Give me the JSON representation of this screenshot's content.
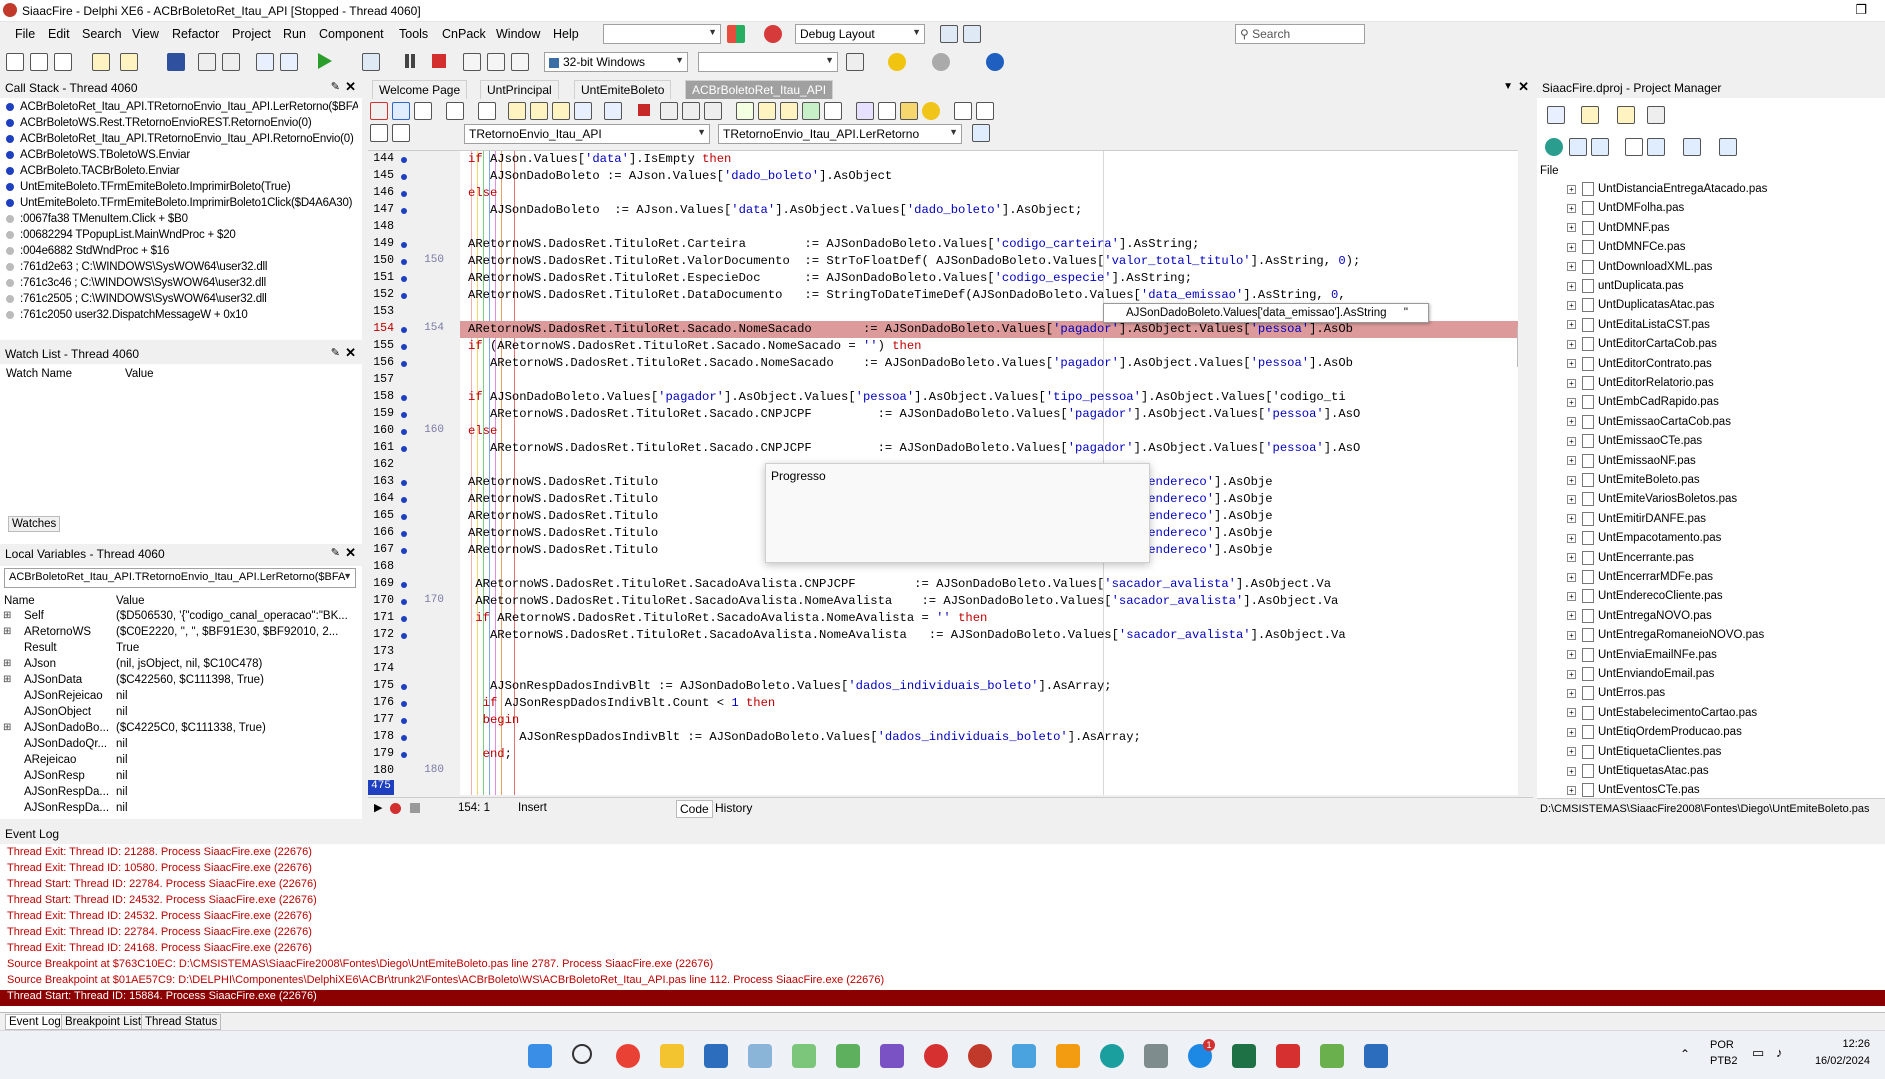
{
  "window": {
    "title": "SiaacFire - Delphi XE6 - ACBrBoletoRet_Itau_API [Stopped - Thread 4060]",
    "restore_glyph": "❐"
  },
  "menu": [
    "File",
    "Edit",
    "Search",
    "View",
    "Refactor",
    "Project",
    "Run",
    "Component",
    "Tools",
    "CnPack",
    "Window",
    "Help"
  ],
  "toolbar": {
    "layout_combo": "Debug Layout",
    "search_placeholder": "Search",
    "platform_combo": "32-bit Windows"
  },
  "callstack": {
    "title": "Call Stack - Thread 4060",
    "rows": [
      "ACBrBoletoRet_Itau_API.TRetornoEnvio_Itau_API.LerRetorno($BFA4",
      "ACBrBoletoWS.Rest.TRetornoEnvioREST.RetornoEnvio(0)",
      "ACBrBoletoRet_Itau_API.TRetornoEnvio_Itau_API.RetornoEnvio(0)",
      "ACBrBoletoWS.TBoletoWS.Enviar",
      "ACBrBoleto.TACBrBoleto.Enviar",
      "UntEmiteBoleto.TFrmEmiteBoleto.ImprimirBoleto(True)",
      "UntEmiteBoleto.TFrmEmiteBoleto.ImprimirBoleto1Click($D4A6A30)",
      ":0067fa38 TMenuItem.Click + $B0",
      ":00682294 TPopupList.MainWndProc + $20",
      ":004e6882 StdWndProc + $16",
      ":761d2e63 ; C:\\WINDOWS\\SysWOW64\\user32.dll",
      ":761c3c46 ; C:\\WINDOWS\\SysWOW64\\user32.dll",
      ":761c2505 ; C:\\WINDOWS\\SysWOW64\\user32.dll",
      ":761c2050 user32.DispatchMessageW + 0x10"
    ]
  },
  "watch": {
    "title": "Watch List - Thread 4060",
    "col_name": "Watch Name",
    "col_value": "Value",
    "tab": "Watches"
  },
  "locals": {
    "title": "Local Variables - Thread 4060",
    "combo": "ACBrBoletoRet_Itau_API.TRetornoEnvio_Itau_API.LerRetorno($BFA",
    "col_name": "Name",
    "col_value": "Value",
    "rows": [
      {
        "name": "Self",
        "value": "($D506530, '{\"codigo_canal_operacao\":\"BK..."
      },
      {
        "name": "ARetornoWS",
        "value": "($C0E2220, '', '', $BF91E30, $BF92010, 2..."
      },
      {
        "name": "Result",
        "value": "True"
      },
      {
        "name": "AJson",
        "value": "(nil, jsObject, nil, $C10C478)"
      },
      {
        "name": "AJSonData",
        "value": "($C422560, $C111398, True)"
      },
      {
        "name": "AJSonRejeicao",
        "value": "nil"
      },
      {
        "name": "AJSonObject",
        "value": "nil"
      },
      {
        "name": "AJSonDadoBo...",
        "value": "($C4225C0, $C111338, True)"
      },
      {
        "name": "AJSonDadoQr...",
        "value": "nil"
      },
      {
        "name": "ARejeicao",
        "value": "nil"
      },
      {
        "name": "AJSonResp",
        "value": "nil"
      },
      {
        "name": "AJSonRespDa...",
        "value": "nil"
      },
      {
        "name": "AJSonRespDa...",
        "value": "nil"
      }
    ]
  },
  "tabs": [
    "Welcome Page",
    "UntPrincipal",
    "UntEmiteBoleto",
    "ACBrBoletoRet_Itau_API"
  ],
  "editor_toolbar": {
    "class_combo": "TRetornoEnvio_Itau_API",
    "method_combo": "TRetornoEnvio_Itau_API.LerRetorno"
  },
  "code_lines": [
    {
      "n": "144",
      "n2": "",
      "t": "if AJson.Values['data'].IsEmpty then"
    },
    {
      "n": "145",
      "n2": "",
      "t": "   AJSonDadoBoleto := AJson.Values['dado_boleto'].AsObject"
    },
    {
      "n": "146",
      "n2": "",
      "t": "else"
    },
    {
      "n": "147",
      "n2": "",
      "t": "   AJSonDadoBoleto  := AJson.Values['data'].AsObject.Values['dado_boleto'].AsObject;"
    },
    {
      "n": "148",
      "n2": "",
      "t": ""
    },
    {
      "n": "149",
      "n2": "",
      "t": "ARetornoWS.DadosRet.TituloRet.Carteira        := AJSonDadoBoleto.Values['codigo_carteira'].AsString;"
    },
    {
      "n": "150",
      "n2": "150",
      "t": "ARetornoWS.DadosRet.TituloRet.ValorDocumento  := StrToFloatDef( AJSonDadoBoleto.Values['valor_total_titulo'].AsString, 0);"
    },
    {
      "n": "151",
      "n2": "",
      "t": "ARetornoWS.DadosRet.TituloRet.EspecieDoc      := AJSonDadoBoleto.Values['codigo_especie'].AsString;"
    },
    {
      "n": "152",
      "n2": "",
      "t": "ARetornoWS.DadosRet.TituloRet.DataDocumento   := StringToDateTimeDef(AJSonDadoBoleto.Values['data_emissao'].AsString, 0,"
    },
    {
      "n": "153",
      "n2": "",
      "t": ""
    },
    {
      "n": "154",
      "n2": "154",
      "t": "ARetornoWS.DadosRet.TituloRet.Sacado.NomeSacado       := AJSonDadoBoleto.Values['pagador'].AsObject.Values['pessoa'].AsOb"
    },
    {
      "n": "155",
      "n2": "",
      "t": "if (ARetornoWS.DadosRet.TituloRet.Sacado.NomeSacado = '') then"
    },
    {
      "n": "156",
      "n2": "",
      "t": "   ARetornoWS.DadosRet.TituloRet.Sacado.NomeSacado    := AJSonDadoBoleto.Values['pagador'].AsObject.Values['pessoa'].AsOb"
    },
    {
      "n": "157",
      "n2": "",
      "t": ""
    },
    {
      "n": "158",
      "n2": "",
      "t": "if AJSonDadoBoleto.Values['pagador'].AsObject.Values['pessoa'].AsObject.Values['tipo_pessoa'].AsObject.Values['codigo_ti"
    },
    {
      "n": "159",
      "n2": "",
      "t": "   ARetornoWS.DadosRet.TituloRet.Sacado.CNPJCPF         := AJSonDadoBoleto.Values['pagador'].AsObject.Values['pessoa'].AsO"
    },
    {
      "n": "160",
      "n2": "160",
      "t": "else"
    },
    {
      "n": "161",
      "n2": "",
      "t": "   ARetornoWS.DadosRet.TituloRet.Sacado.CNPJCPF         := AJSonDadoBoleto.Values['pagador'].AsObject.Values['pessoa'].AsO"
    },
    {
      "n": "162",
      "n2": "",
      "t": ""
    },
    {
      "n": "163",
      "n2": "",
      "t": "ARetornoWS.DadosRet.Titulo                                       'pagador'].AsObject.Values['endereco'].AsObje"
    },
    {
      "n": "164",
      "n2": "",
      "t": "ARetornoWS.DadosRet.Titulo                                       'pagador'].AsObject.Values['endereco'].AsObje"
    },
    {
      "n": "165",
      "n2": "",
      "t": "ARetornoWS.DadosRet.Titulo                                       'pagador'].AsObject.Values['endereco'].AsObje"
    },
    {
      "n": "166",
      "n2": "",
      "t": "ARetornoWS.DadosRet.Titulo                                       'pagador'].AsObject.Values['endereco'].AsObje"
    },
    {
      "n": "167",
      "n2": "",
      "t": "ARetornoWS.DadosRet.Titulo                                       'pagador'].AsObject.Values['endereco'].AsObje"
    },
    {
      "n": "168",
      "n2": "",
      "t": ""
    },
    {
      "n": "169",
      "n2": "",
      "t": " ARetornoWS.DadosRet.TituloRet.SacadoAvalista.CNPJCPF        := AJSonDadoBoleto.Values['sacador_avalista'].AsObject.Va"
    },
    {
      "n": "170",
      "n2": "170",
      "t": " ARetornoWS.DadosRet.TituloRet.SacadoAvalista.NomeAvalista    := AJSonDadoBoleto.Values['sacador_avalista'].AsObject.Va"
    },
    {
      "n": "171",
      "n2": "",
      "t": " if ARetornoWS.DadosRet.TituloRet.SacadoAvalista.NomeAvalista = '' then"
    },
    {
      "n": "172",
      "n2": "",
      "t": "   ARetornoWS.DadosRet.TituloRet.SacadoAvalista.NomeAvalista   := AJSonDadoBoleto.Values['sacador_avalista'].AsObject.Va"
    },
    {
      "n": "173",
      "n2": "",
      "t": ""
    },
    {
      "n": "174",
      "n2": "",
      "t": ""
    },
    {
      "n": "175",
      "n2": "",
      "t": "   AJSonRespDadosIndivBlt := AJSonDadoBoleto.Values['dados_individuais_boleto'].AsArray;"
    },
    {
      "n": "176",
      "n2": "",
      "t": "  if AJSonRespDadosIndivBlt.Count < 1 then"
    },
    {
      "n": "177",
      "n2": "",
      "t": "  begin"
    },
    {
      "n": "178",
      "n2": "",
      "t": "       AJSonRespDadosIndivBlt := AJSonDadoBoleto.Values['dados_individuais_boleto'].AsArray;"
    },
    {
      "n": "179",
      "n2": "",
      "t": "  end;"
    },
    {
      "n": "180",
      "n2": "180",
      "t": ""
    }
  ],
  "editor_status": {
    "cursor": "154:  1",
    "mode": "Insert",
    "tab_code": "Code",
    "tab_history": "History",
    "linecount": "475"
  },
  "dialog": {
    "title": "Progresso"
  },
  "hint": {
    "text": "AJSonDadoBoleto.Values['data_emissao'].AsString",
    "value": "''"
  },
  "project_manager": {
    "title": "SiaacFire.dproj - Project Manager",
    "col_file": "File",
    "files": [
      "UntDistanciaEntregaAtacado.pas",
      "UntDMFolha.pas",
      "UntDMNF.pas",
      "UntDMNFCe.pas",
      "UntDownloadXML.pas",
      "untDuplicata.pas",
      "UntDuplicatasAtac.pas",
      "UntEditaListaCST.pas",
      "UntEditorCartaCob.pas",
      "UntEditorContrato.pas",
      "UntEditorRelatorio.pas",
      "UntEmbCadRapido.pas",
      "UntEmissaoCartaCob.pas",
      "UntEmissaoCTe.pas",
      "UntEmissaoNF.pas",
      "UntEmiteBoleto.pas",
      "UntEmiteVariosBoletos.pas",
      "UntEmitirDANFE.pas",
      "UntEmpacotamento.pas",
      "UntEncerrante.pas",
      "UntEncerrarMDFe.pas",
      "UntEnderecoCliente.pas",
      "UntEntregaNOVO.pas",
      "UntEntregaRomaneioNOVO.pas",
      "UntEnviaEmailNFe.pas",
      "UntEnviandoEmail.pas",
      "UntErros.pas",
      "UntEstabelecimentoCartao.pas",
      "UntEtiqOrdemProducao.pas",
      "UntEtiquetaClientes.pas",
      "UntEtiquetasAtac.pas",
      "UntEventosCTe.pas"
    ],
    "status_path": "D:\\CMSISTEMAS\\SiaacFire2008\\Fontes\\Diego\\UntEmiteBoleto.pas"
  },
  "eventlog": {
    "title": "Event Log",
    "rows": [
      "Thread Exit: Thread ID: 21288. Process SiaacFire.exe (22676)",
      "Thread Exit: Thread ID: 10580. Process SiaacFire.exe (22676)",
      "Thread Start: Thread ID: 22784. Process SiaacFire.exe (22676)",
      "Thread Start: Thread ID: 24532. Process SiaacFire.exe (22676)",
      "Thread Exit: Thread ID: 24532. Process SiaacFire.exe (22676)",
      "Thread Exit: Thread ID: 22784. Process SiaacFire.exe (22676)",
      "Thread Exit: Thread ID: 24168. Process SiaacFire.exe (22676)",
      "Source Breakpoint at $763C10EC: D:\\CMSISTEMAS\\SiaacFire2008\\Fontes\\Diego\\UntEmiteBoleto.pas line 2787. Process SiaacFire.exe (22676)",
      "Source Breakpoint at $01AE57C9: D:\\DELPHI\\Componentes\\DelphiXE6\\ACBr\\trunk2\\Fontes\\ACBrBoleto\\WS\\ACBrBoletoRet_Itau_API.pas line 112. Process SiaacFire.exe (22676)",
      "Thread Start: Thread ID: 15884. Process SiaacFire.exe (22676)"
    ],
    "tabs": [
      "Event Log",
      "Breakpoint List",
      "Thread Status"
    ]
  },
  "taskbar": {
    "lang1": "POR",
    "lang2": "PTB2",
    "time": "12:26",
    "date": "16/02/2024",
    "badge": "1"
  },
  "colors": {
    "accent": "#1e3fbf",
    "keyword": "#c00000",
    "string": "#0000c0",
    "highlight_line": "#dc9a9a",
    "selected_event": "#8b0000"
  }
}
